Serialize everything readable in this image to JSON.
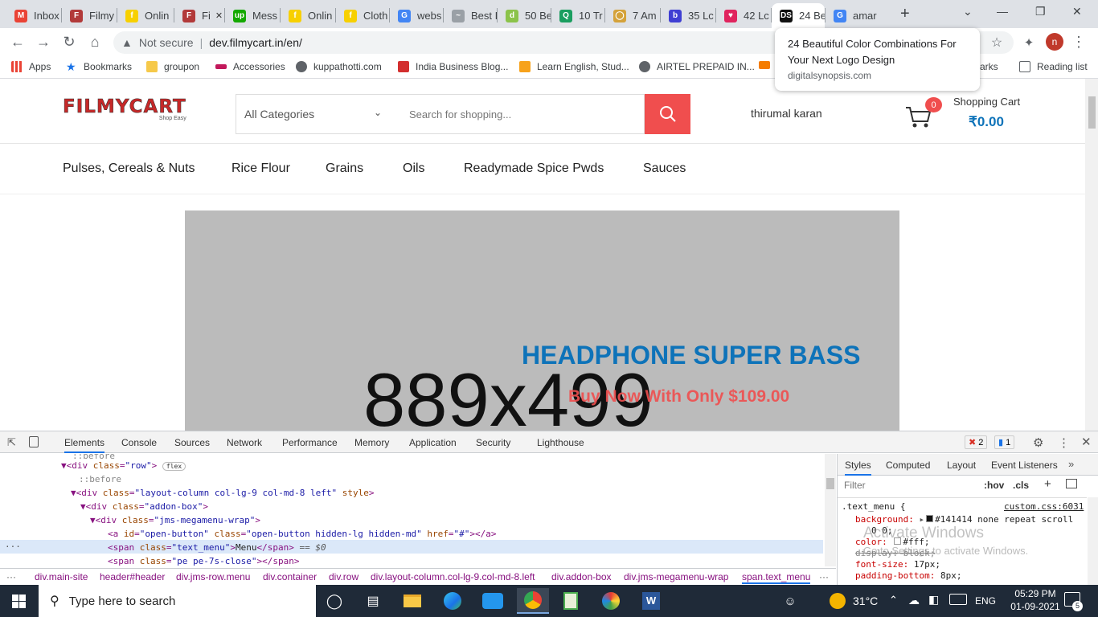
{
  "tabs": [
    {
      "label": "Inbox",
      "color": "#ea4335",
      "glyph": "M"
    },
    {
      "label": "Filmy",
      "color": "#b23a3a",
      "glyph": "F"
    },
    {
      "label": "Onlin",
      "color": "#f7d000",
      "glyph": "f"
    },
    {
      "label": "Fi",
      "color": "#b23a3a",
      "glyph": "F"
    },
    {
      "label": "Mess",
      "color": "#14a800",
      "glyph": "up"
    },
    {
      "label": "Onlin",
      "color": "#f7d000",
      "glyph": "f"
    },
    {
      "label": "Cloth",
      "color": "#f7d000",
      "glyph": "f"
    },
    {
      "label": "webs",
      "color": "#4285f4",
      "glyph": "G"
    },
    {
      "label": "Best I",
      "color": "#9aa0a6",
      "glyph": "~"
    },
    {
      "label": "50 Be",
      "color": "#8bc34a",
      "glyph": "d"
    },
    {
      "label": "10 Tr",
      "color": "#1a9e5f",
      "glyph": "Q"
    },
    {
      "label": "7 Am",
      "color": "#d4a23a",
      "glyph": "◯"
    },
    {
      "label": "35 Lc",
      "color": "#3f3fd3",
      "glyph": "b"
    },
    {
      "label": "42 Lc",
      "color": "#e0245e",
      "glyph": "♥"
    },
    {
      "label": "24 Be",
      "color": "#111111",
      "glyph": "DS"
    },
    {
      "label": "amar",
      "color": "#4285f4",
      "glyph": "G"
    }
  ],
  "toolbar": {
    "security_label": "Not secure",
    "url": "dev.filmycart.in/en/",
    "profile_initial": "n"
  },
  "tooltip": {
    "title": "24 Beautiful Color Combinations For Your Next Logo Design",
    "domain": "digitalsynopsis.com"
  },
  "bookmarks": [
    "Apps",
    "Bookmarks",
    "groupon",
    "Accessories",
    "kuppathotti.com",
    "India Business Blog...",
    "Learn English, Stud...",
    "AIRTEL PREPAID IN...",
    "marks",
    "Reading list"
  ],
  "site": {
    "logo_text": "FILMYCART",
    "logo_tagline": "Shop Easy",
    "category_select": "All Categories",
    "search_placeholder": "Search for shopping...",
    "user_name": "thirumal karan",
    "cart_count": "0",
    "cart_label": "Shopping Cart",
    "cart_total": "₹0.00",
    "menu": [
      "Pulses, Cereals & Nuts",
      "Rice Flour",
      "Grains",
      "Oils",
      "Readymade Spice Pwds",
      "Sauces"
    ],
    "banner": {
      "placeholder": "889x499",
      "headline": "HEADPHONE SUPER BASS",
      "cta": "Buy Now With Only $109.00"
    },
    "colors": {
      "accent": "#f04e4e",
      "headline": "#0e73b9",
      "banner_bg": "#bbbbbb"
    }
  },
  "devtools": {
    "tabs": [
      "Elements",
      "Console",
      "Sources",
      "Network",
      "Performance",
      "Memory",
      "Application",
      "Security",
      "Lighthouse"
    ],
    "errors": "2",
    "messages": "1",
    "style_tabs": [
      "Styles",
      "Computed",
      "Layout",
      "Event Listeners"
    ],
    "filter_placeholder": "Filter",
    "hov": ":hov",
    "cls": ".cls",
    "crumbs": [
      "div.main-site",
      "header#header",
      "div.jms-row.menu",
      "div.container",
      "div.row",
      "div.layout-column.col-lg-9.col-md-8.left",
      "div.addon-box",
      "div.jms-megamenu-wrap",
      "span.text_menu"
    ],
    "css": {
      "selector": ".text_menu {",
      "source": "custom.css:6031",
      "props": [
        {
          "name": "background:",
          "value": "#141414 none repeat scroll"
        },
        {
          "name": "",
          "value": "0 0;"
        },
        {
          "name": "color:",
          "value": "#fff;"
        },
        {
          "name": "display:",
          "value": "block;"
        },
        {
          "name": "font-size:",
          "value": "17px;"
        },
        {
          "name": "padding-bottom:",
          "value": "8px;"
        }
      ]
    },
    "watermark1": "Activate Windows",
    "watermark2": "Go to Settings to activate Windows."
  },
  "taskbar": {
    "search_placeholder": "Type here to search",
    "temperature": "31°C",
    "language": "ENG",
    "time": "05:29 PM",
    "date": "01-09-2021",
    "notifications": "5"
  }
}
